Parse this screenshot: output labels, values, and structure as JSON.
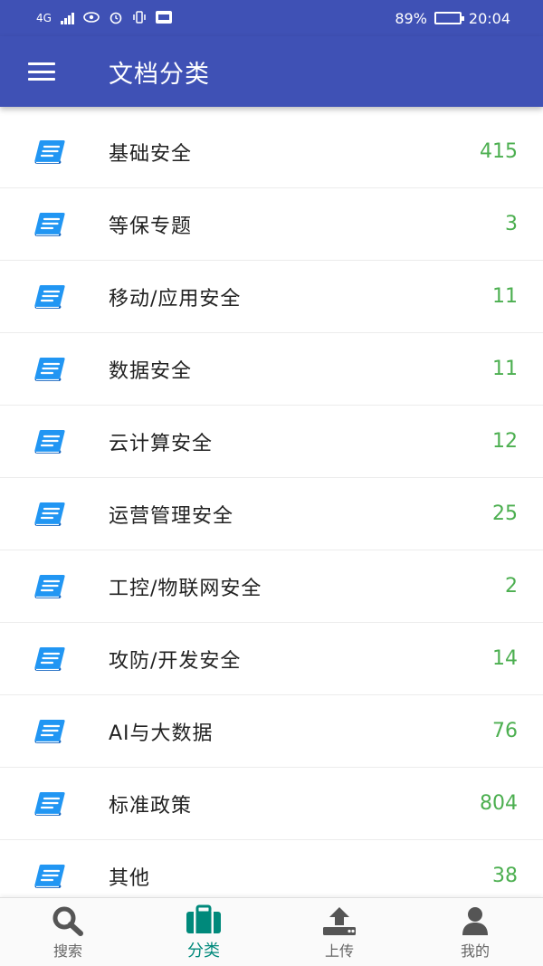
{
  "statusbar": {
    "network": "4G",
    "battery_text": "89%",
    "battery_level": 0.89,
    "time": "20:04"
  },
  "appbar": {
    "title": "文档分类",
    "menu_icon": "hamburger-menu-icon"
  },
  "categories": [
    {
      "label": "基础安全",
      "count": "415"
    },
    {
      "label": "等保专题",
      "count": "3"
    },
    {
      "label": "移动/应用安全",
      "count": "11"
    },
    {
      "label": "数据安全",
      "count": "11"
    },
    {
      "label": "云计算安全",
      "count": "12"
    },
    {
      "label": "运营管理安全",
      "count": "25"
    },
    {
      "label": "工控/物联网安全",
      "count": "2"
    },
    {
      "label": "攻防/开发安全",
      "count": "14"
    },
    {
      "label": "AI与大数据",
      "count": "76"
    },
    {
      "label": "标准政策",
      "count": "804"
    },
    {
      "label": "其他",
      "count": "38"
    }
  ],
  "bottom_nav": [
    {
      "label": "搜索",
      "icon": "search-icon"
    },
    {
      "label": "分类",
      "icon": "briefcase-icon",
      "active": true
    },
    {
      "label": "上传",
      "icon": "upload-icon"
    },
    {
      "label": "我的",
      "icon": "user-icon"
    }
  ],
  "colors": {
    "primary": "#3f51b5",
    "count": "#4caf50",
    "book_icon": "#2196f3",
    "nav_active": "#00897b",
    "nav_inactive": "#666666"
  }
}
